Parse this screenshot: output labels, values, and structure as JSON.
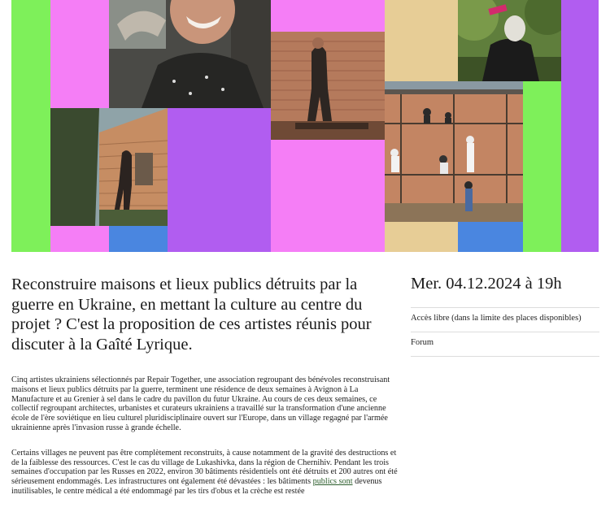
{
  "hero": {
    "colors": {
      "green": "#7ef05a",
      "pink": "#f57ef6",
      "violet": "#b15df0",
      "blue": "#4a86e0",
      "tan": "#e7cd96",
      "white": "#ffffff"
    },
    "photos": [
      "portrait-man-photo",
      "woman-painting-wall-photo",
      "person-drinking-photo",
      "man-on-ladder-photo",
      "scaffolding-workers-photo"
    ]
  },
  "event": {
    "lede": "Reconstruire maisons et lieux publics détruits par la guerre en Ukraine, en mettant la culture au centre du projet ? C'est la proposition de ces artistes réunis pour discuter à la Gaîté Lyrique.",
    "date": "Mer. 04.12.2024 à 19h",
    "access": "Accès libre (dans la limite des places disponibles)",
    "category": "Forum"
  },
  "body": {
    "p1": "Cinq artistes ukrainiens sélectionnés par Repair Together, une association regroupant des bénévoles reconstruisant maisons et lieux publics détruits par la guerre, terminent une résidence de deux semaines à Avignon à La Manufacture et au Grenier à sel dans le cadre du pavillon du futur Ukraine. Au cours de ces deux semaines, ce collectif regroupant architectes, urbanistes et curateurs ukrainiens a travaillé sur la transformation d'une ancienne école de l'ère soviétique en lieu culturel pluridisciplinaire ouvert sur l'Europe, dans un village regagné par l'armée ukrainienne après l'invasion russe à grande échelle.",
    "p2_start": "Certains villages ne peuvent pas être complètement reconstruits, à cause notamment de la gravité des destructions et de la faiblesse des ressources. C'est le cas du village de Lukashivka, dans la région de Chernihiv. Pendant les trois semaines d'occupation par les Russes en 2022, environ 30 bâtiments résidentiels ont été détruits et 200 autres ont été sérieusement endommagés. Les infrastructures ont également été dévastées : les bâtiments ",
    "p2_link": "publics sont",
    "p2_end": " devenus inutilisables, le centre médical a été endommagé par les tirs d'obus et la crèche est restée"
  }
}
